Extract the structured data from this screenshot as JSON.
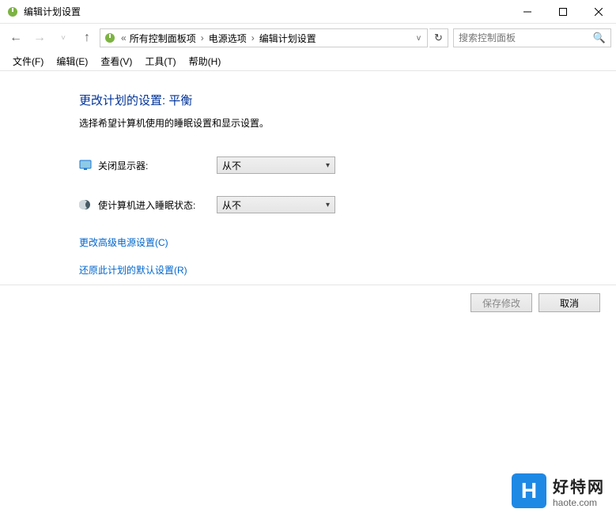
{
  "window": {
    "title": "编辑计划设置"
  },
  "nav": {
    "breadcrumb": {
      "item1": "所有控制面板项",
      "item2": "电源选项",
      "item3": "编辑计划设置"
    },
    "search_placeholder": "搜索控制面板"
  },
  "menu": {
    "file": "文件(F)",
    "edit": "编辑(E)",
    "view": "查看(V)",
    "tools": "工具(T)",
    "help": "帮助(H)"
  },
  "content": {
    "heading": "更改计划的设置: 平衡",
    "subtext": "选择希望计算机使用的睡眠设置和显示设置。",
    "display_off_label": "关闭显示器:",
    "display_off_value": "从不",
    "sleep_label": "使计算机进入睡眠状态:",
    "sleep_value": "从不",
    "link_advanced": "更改高级电源设置(C)",
    "link_restore": "还原此计划的默认设置(R)",
    "save_btn": "保存修改",
    "cancel_btn": "取消"
  },
  "watermark": {
    "logo_letter": "H",
    "cn": "好特网",
    "en": "haote.com"
  }
}
